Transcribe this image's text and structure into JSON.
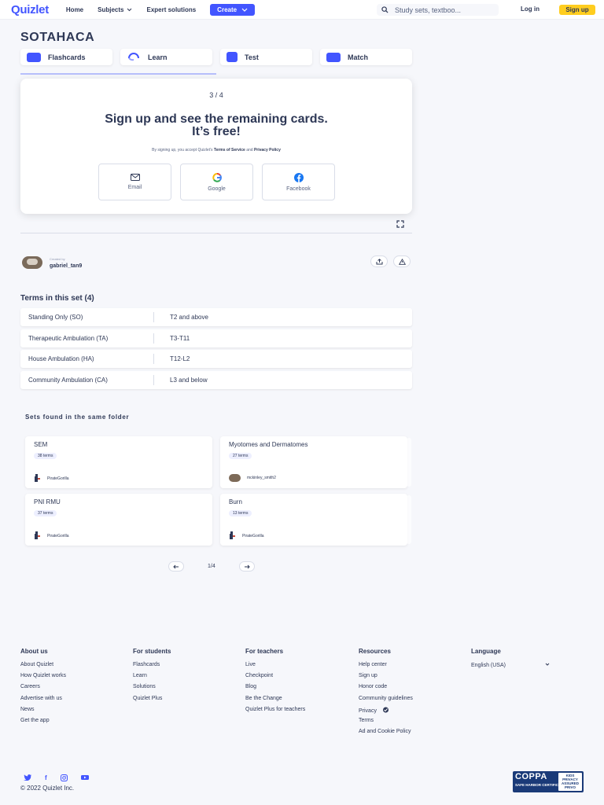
{
  "header": {
    "logo": "Quizlet",
    "nav": [
      "Home",
      "Subjects",
      "Expert solutions"
    ],
    "create_label": "Create",
    "search_placeholder": "Study sets, textboo...",
    "login_label": "Log in",
    "signup_label": "Sign up"
  },
  "set": {
    "title": "SOTAHACA",
    "modes": [
      "Flashcards",
      "Learn",
      "Test",
      "Match"
    ]
  },
  "modal": {
    "counter": "3 / 4",
    "title_line1": "Sign up and see the remaining cards.",
    "title_line2": "It’s free!",
    "fine_prefix": "By signing up, you accept Quizlet's",
    "fine_terms": "Terms of Service",
    "fine_and": "and",
    "fine_privacy": "Privacy Policy",
    "auth": [
      "Email",
      "Google",
      "Facebook"
    ]
  },
  "creator": {
    "created_by": "Created by",
    "name": "gabriel_tan9"
  },
  "terms": {
    "heading": "Terms in this set (4)",
    "rows": [
      {
        "term": "Standing Only (SO)",
        "definition": "T2 and above"
      },
      {
        "term": "Therapeutic Ambulation (TA)",
        "definition": "T3-T11"
      },
      {
        "term": "House Ambulation (HA)",
        "definition": "T12-L2"
      },
      {
        "term": "Community Ambulation (CA)",
        "definition": "L3 and below"
      }
    ]
  },
  "folder_sets": {
    "heading": "Sets found in the same folder",
    "cards": [
      {
        "title": "SEM",
        "count": "38 terms",
        "owner": "PirateGorilla"
      },
      {
        "title": "Myotomes and Dermatomes",
        "count": "27 terms",
        "owner": "mckinley_smith2"
      },
      {
        "title": "PNI RMU",
        "count": "37 terms",
        "owner": "PirateGorilla"
      },
      {
        "title": "Burn",
        "count": "13 terms",
        "owner": "PirateGorilla"
      }
    ],
    "page": "1/4"
  },
  "footer": {
    "about": {
      "heading": "About us",
      "links": [
        "About Quizlet",
        "How Quizlet works",
        "Careers",
        "Advertise with us",
        "News",
        "Get the app"
      ]
    },
    "students": {
      "heading": "For students",
      "links": [
        "Flashcards",
        "Learn",
        "Solutions",
        "Quizlet Plus"
      ]
    },
    "teachers": {
      "heading": "For teachers",
      "links": [
        "Live",
        "Checkpoint",
        "Blog",
        "Be the Change",
        "Quizlet Plus for teachers"
      ]
    },
    "resources": {
      "heading": "Resources",
      "links": [
        "Help center",
        "Sign up",
        "Honor code",
        "Community guidelines",
        "Privacy",
        "Terms",
        "Ad and Cookie Policy"
      ]
    },
    "language": {
      "heading": "Language",
      "value": "English (USA)"
    },
    "copyright": "© 2022 Quizlet Inc.",
    "coppa_big": "COPPA",
    "coppa_small": "SAFE HARBOR CERTIFICATION",
    "privo": "KIDS PRIVACY ASSURED PRIVO"
  },
  "colors": {
    "brand": "#4255ff",
    "signup": "#ffcd1f",
    "text": "#2e3856"
  }
}
